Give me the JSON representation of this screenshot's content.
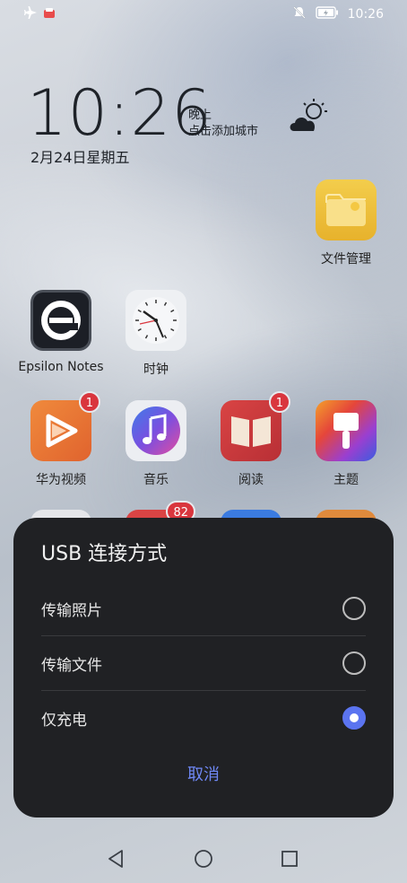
{
  "status_bar": {
    "time": "10:26",
    "icons": [
      "airplane-icon",
      "notification-app-icon",
      "mute-icon",
      "battery-charging-icon"
    ]
  },
  "clock_widget": {
    "time": "10:26",
    "period": "晚上",
    "city_prompt": "点击添加城市",
    "date": "2月24日星期五",
    "weather_icon": "cloudy-night-icon"
  },
  "apps": {
    "file_manager": {
      "label": "文件管理"
    },
    "epsilon_notes": {
      "label": "Epsilon Notes"
    },
    "clock": {
      "label": "时钟"
    },
    "huawei_video": {
      "label": "华为视频",
      "badge": "1"
    },
    "music": {
      "label": "音乐"
    },
    "reading": {
      "label": "阅读",
      "badge": "1"
    },
    "themes": {
      "label": "主题"
    },
    "partial_badge": "82"
  },
  "dialog": {
    "title": "USB 连接方式",
    "options": [
      {
        "label": "传输照片",
        "checked": false
      },
      {
        "label": "传输文件",
        "checked": false
      },
      {
        "label": "仅充电",
        "checked": true
      }
    ],
    "cancel_label": "取消"
  },
  "colors": {
    "accent": "#5b74f0",
    "cancel_text": "#6f88f5",
    "dialog_bg": "#202124",
    "badge": "#d9363e"
  },
  "nav": {
    "icons": [
      "back-icon",
      "home-icon",
      "recents-icon"
    ]
  }
}
